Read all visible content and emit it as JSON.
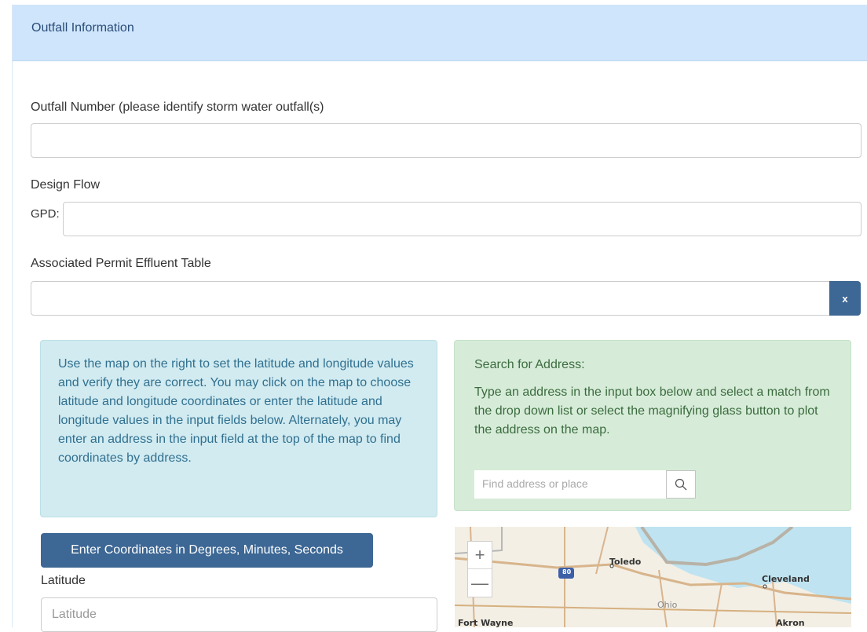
{
  "panel": {
    "title": "Outfall Information"
  },
  "form": {
    "outfall_number_label": "Outfall Number (please identify storm water outfall(s)",
    "outfall_number_value": "",
    "design_flow_label": "Design Flow",
    "gpd_label": "GPD:",
    "gpd_value": "",
    "effluent_table_label": "Associated Permit Effluent Table",
    "effluent_table_value": "",
    "clear_button_label": "x"
  },
  "info": {
    "text": "Use the map on the right to set the latitude and longitude values and verify they are correct. You may click on the map to choose latitude and longitude coordinates or enter the latitude and longitude values in the input fields below. Alternately, you may enter an address in the input field at the top of the map to find coordinates by address."
  },
  "search": {
    "title": "Search for Address:",
    "text": "Type an address in the input box below and select a match from the drop down list or select the magnifying glass button to plot the address on the map.",
    "placeholder": "Find address or place",
    "button_icon": "search-icon"
  },
  "coordinates": {
    "button_label": "Enter Coordinates in Degrees, Minutes, Seconds",
    "latitude_label": "Latitude",
    "latitude_placeholder": "Latitude"
  },
  "map": {
    "zoom_in": "+",
    "zoom_out": "—",
    "labels": {
      "toledo": "Toledo",
      "cleveland": "Cleveland",
      "ohio": "Ohio",
      "fort_wayne": "Fort Wayne",
      "akron": "Akron",
      "highway": "80"
    }
  },
  "colors": {
    "heading_bg": "#cfe5fb",
    "primary_button": "#3d6794",
    "info_bg": "#d1ebf1",
    "success_bg": "#d6ecd8"
  }
}
